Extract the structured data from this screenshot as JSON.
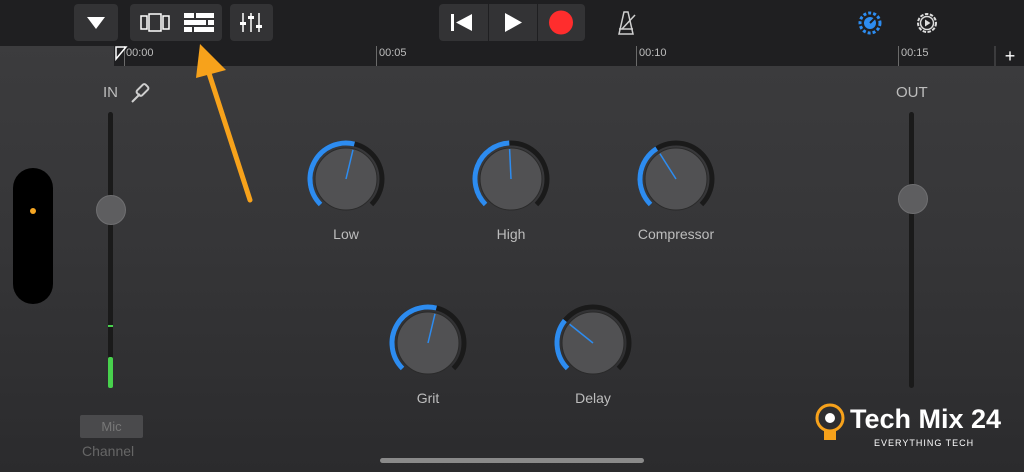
{
  "toolbar": {
    "items": [
      {
        "name": "browser-dropdown-button"
      },
      {
        "name": "view-tracks-button"
      },
      {
        "name": "view-tracks-list-button"
      },
      {
        "name": "mixer-controls-button"
      },
      {
        "name": "go-to-beginning-button"
      },
      {
        "name": "play-button"
      },
      {
        "name": "record-button"
      },
      {
        "name": "metronome-button"
      },
      {
        "name": "master-volume-knob-button"
      },
      {
        "name": "settings-button"
      }
    ],
    "accent_color": "#2d8cf0",
    "record_color": "#ff2d2d"
  },
  "ruler": {
    "markers": [
      "00:00",
      "00:05",
      "00:10",
      "00:15"
    ],
    "add_label": "+"
  },
  "input": {
    "label": "IN",
    "level": 0.12,
    "slider_level": 0.65
  },
  "output": {
    "label": "OUT",
    "slider_level": 0.69
  },
  "knobs": [
    {
      "label": "Low",
      "value": 0.55
    },
    {
      "label": "High",
      "value": 0.49
    },
    {
      "label": "Compressor",
      "value": 0.38
    },
    {
      "label": "Grit",
      "value": 0.55
    },
    {
      "label": "Delay",
      "value": 0.31
    }
  ],
  "footer": {
    "mic_button": "Mic",
    "channel_label": "Channel"
  },
  "watermark": {
    "brand": "Tech Mix 24",
    "tagline": "EVERYTHING TECH"
  }
}
